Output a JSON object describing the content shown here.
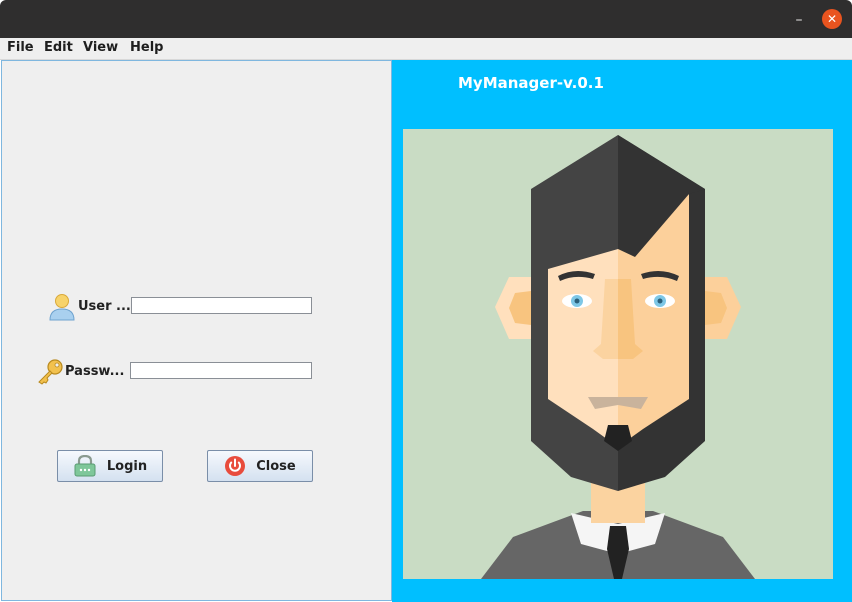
{
  "window": {
    "minimize_glyph": "–",
    "close_glyph": "✕"
  },
  "menu": {
    "items": [
      "File",
      "Edit",
      "View",
      "Help"
    ]
  },
  "login": {
    "username_label": "User ...",
    "username_value": "",
    "password_label": "Passw...",
    "password_value": "",
    "login_button": "Login",
    "close_button": "Close"
  },
  "brand": {
    "title": "MyManager-v.0.1"
  },
  "colors": {
    "accent": "#00bfff",
    "close_button": "#e9541f",
    "power_icon": "#e84c3d"
  },
  "icons": [
    "user-icon",
    "key-icon",
    "padlock-icon",
    "power-icon",
    "avatar-illustration"
  ]
}
